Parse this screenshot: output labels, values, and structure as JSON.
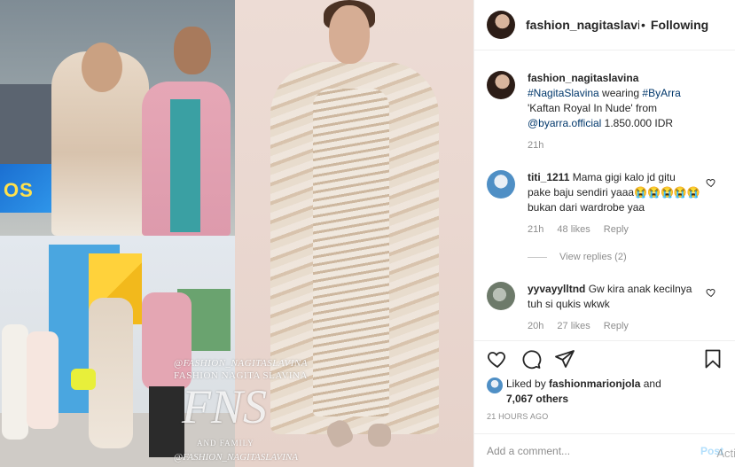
{
  "post": {
    "username": "fashion_nagitaslavina",
    "follow_status": "Following",
    "dot": "•"
  },
  "media": {
    "watermark_handle": "@FASHION_NAGITASLAVINA",
    "watermark_brand": "FASHION NAGITA SLAVINA",
    "watermark_logo": "FNS",
    "watermark_family": "AND FAMILY",
    "watermark_handle2": "@FASHION_NAGITASLAVINA",
    "screen_text": "OS"
  },
  "caption": {
    "username": "fashion_nagitaslavina",
    "hashtag1": "#NagitaSlavina",
    "text1": " wearing ",
    "hashtag2": "#ByArra",
    "text2": "'Kaftan Royal In Nude' from",
    "mention": "@byarra.official",
    "text3": " 1.850.000 IDR",
    "time": "21h"
  },
  "comments": [
    {
      "username": "titi_1211",
      "text": "Mama gigi kalo jd gitu pake baju sendiri yaaa😭😭😭😭😭 bukan dari wardrobe yaa",
      "time": "21h",
      "likes": "48 likes",
      "reply": "Reply",
      "view_replies": "View replies (2)"
    },
    {
      "username": "yyvayylltnd",
      "text": "Gw kira anak kecilnya tuh si qukis wkwk",
      "time": "20h",
      "likes": "27 likes",
      "reply": "Reply"
    }
  ],
  "likes": {
    "prefix": "Liked by ",
    "user": "fashionmarionjola",
    "and": " and",
    "others": "7,067 others"
  },
  "timestamp": "21 HOURS AGO",
  "add_comment": {
    "placeholder": "Add a comment...",
    "post_label": "Post",
    "overlay": "Acti"
  },
  "icons": [
    "heart-icon",
    "comment-icon",
    "share-icon",
    "bookmark-icon",
    "more-icon"
  ],
  "colors": {
    "link": "#00376b",
    "muted": "#8e8e8e",
    "post_btn": "#b2dffc"
  }
}
